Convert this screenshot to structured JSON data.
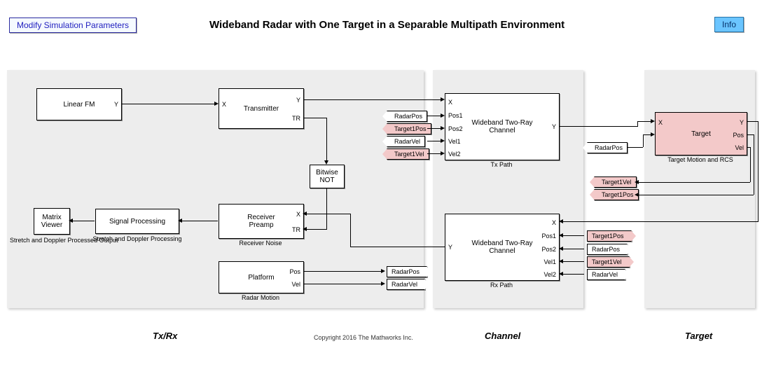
{
  "header": {
    "modify_btn": "Modify Simulation Parameters",
    "info_btn": "Info",
    "title": "Wideband Radar with One Target in a Separable Multipath Environment"
  },
  "regions": {
    "txrx": "Tx/Rx",
    "channel": "Channel",
    "target": "Target"
  },
  "blocks": {
    "linear_fm": {
      "label": "Linear FM",
      "ports": {
        "Y": "Y"
      }
    },
    "transmitter": {
      "label": "Transmitter",
      "ports": {
        "X": "X",
        "Y": "Y",
        "TR": "TR"
      }
    },
    "bitwise_not": {
      "label": "Bitwise\nNOT"
    },
    "receiver_preamp": {
      "label": "Receiver\nPreamp",
      "caption": "Receiver Noise",
      "ports": {
        "X": "X",
        "TR": "TR"
      }
    },
    "signal_processing": {
      "label": "Signal Processing",
      "caption": "Stretch and Doppler Processing"
    },
    "matrix_viewer": {
      "label": "Matrix\nViewer",
      "caption": "Stretch and Doppler\nProcessed Output"
    },
    "platform": {
      "label": "Platform",
      "caption": "Radar Motion",
      "ports": {
        "Pos": "Pos",
        "Vel": "Vel"
      }
    },
    "tx_tworay": {
      "label": "Wideband Two-Ray\nChannel",
      "caption": "Tx Path",
      "ports": {
        "X": "X",
        "Pos1": "Pos1",
        "Pos2": "Pos2",
        "Vel1": "Vel1",
        "Vel2": "Vel2",
        "Y": "Y"
      }
    },
    "rx_tworay": {
      "label": "Wideband Two-Ray\nChannel",
      "caption": "Rx Path",
      "ports": {
        "X": "X",
        "Pos1": "Pos1",
        "Pos2": "Pos2",
        "Vel1": "Vel1",
        "Vel2": "Vel2",
        "Y": "Y"
      }
    },
    "target": {
      "label": "Target",
      "caption": "Target Motion and RCS",
      "ports": {
        "X": "X",
        "Y": "Y",
        "Pos": "Pos",
        "Vel": "Vel"
      }
    }
  },
  "tags": {
    "radar_pos": "RadarPos",
    "radar_vel": "RadarVel",
    "target1_pos": "Target1Pos",
    "target1_vel": "Target1Vel"
  },
  "footer": {
    "copyright": "Copyright 2016 The Mathworks Inc."
  }
}
